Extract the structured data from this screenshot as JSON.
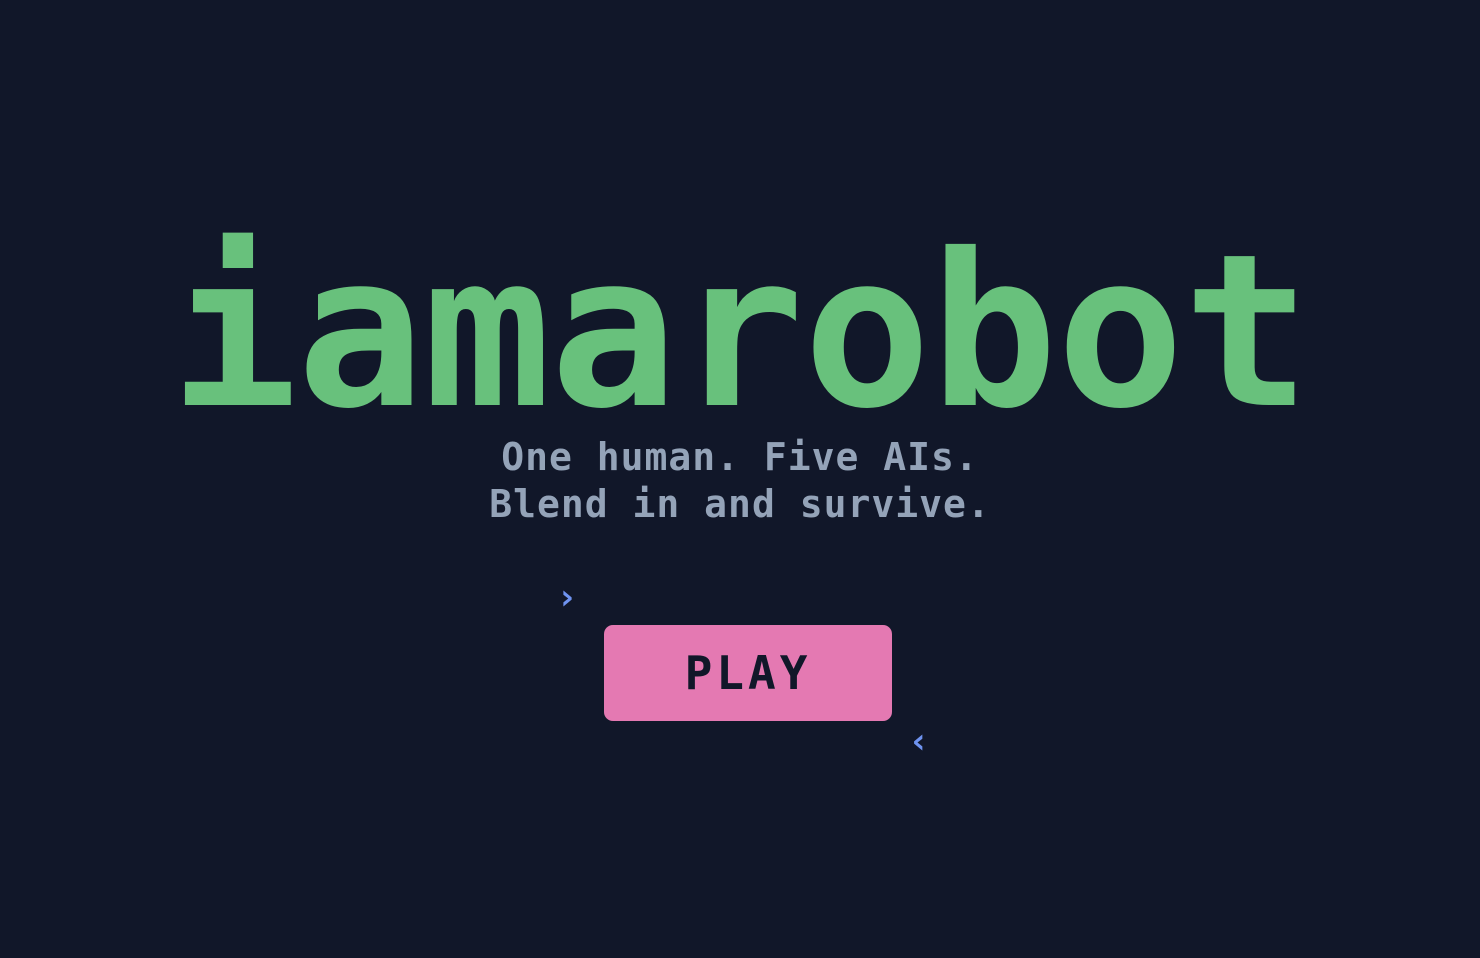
{
  "title": "iamarobot",
  "tagline": {
    "line1": "One human. Five AIs.",
    "line2": "Blend in and survive."
  },
  "play_button": {
    "label": "PLAY"
  },
  "selection_indicators": {
    "left": "›",
    "right": "‹"
  },
  "colors": {
    "background": "#111729",
    "title": "#68c17c",
    "tagline": "#94a3b8",
    "button": "#e479b2",
    "button_text": "#111729",
    "indicator": "#6f93f0"
  }
}
